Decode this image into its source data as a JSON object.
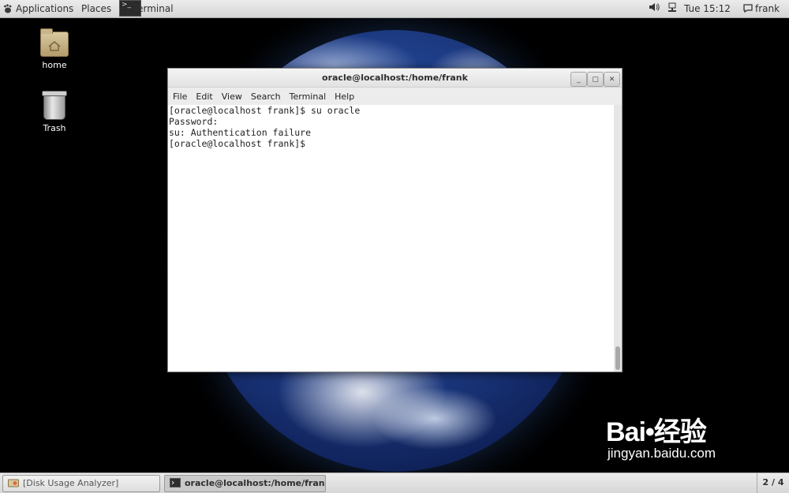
{
  "top_panel": {
    "applications_label": "Applications",
    "places_label": "Places",
    "task_label": "Terminal",
    "clock": "Tue 15:12",
    "user": "frank"
  },
  "desktop": {
    "icons": [
      {
        "label": "home",
        "icon": "folder-home-icon"
      },
      {
        "label": "Trash",
        "icon": "trash-icon"
      }
    ]
  },
  "terminal": {
    "title": "oracle@localhost:/home/frank",
    "menu": [
      "File",
      "Edit",
      "View",
      "Search",
      "Terminal",
      "Help"
    ],
    "lines": [
      "[oracle@localhost frank]$ su oracle",
      "Password:",
      "su: Authentication failure",
      "[oracle@localhost frank]$ "
    ],
    "buttons": {
      "minimize": "_",
      "maximize": "▢",
      "close": "✕"
    }
  },
  "bottom_panel": {
    "tasks": [
      {
        "label": "[Disk Usage Analyzer]",
        "icon": "disk-usage-icon"
      },
      {
        "label": "oracle@localhost:/home/frank",
        "icon": "terminal-icon"
      }
    ],
    "workspace": "2 / 4"
  },
  "watermark": {
    "brand": "Bai•经验",
    "site": "jingyan.baidu.com"
  },
  "colors": {
    "panel": "#e2e2e2",
    "terminal_bg": "#ffffff",
    "desktop_bg": "#000000"
  }
}
